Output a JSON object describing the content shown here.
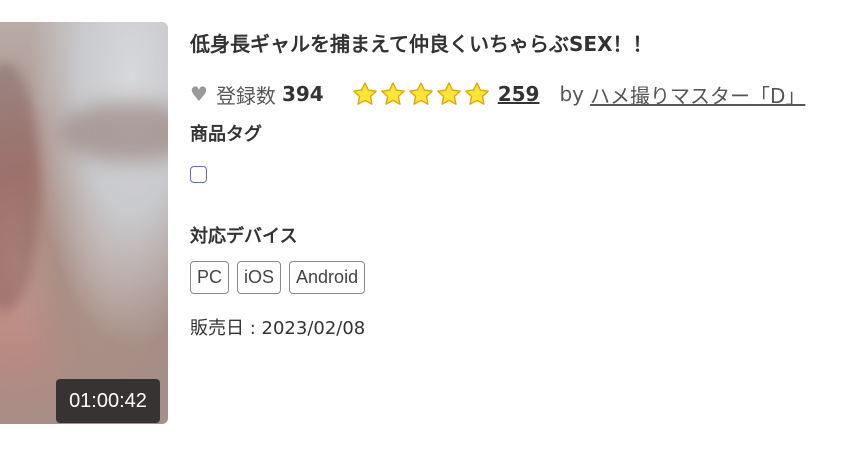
{
  "thumbnail": {
    "duration": "01:00:42"
  },
  "product": {
    "title": "低身長ギャルを捕まえて仲良くいちゃらぶSEX！！",
    "heart_icon": "♥",
    "favorites_label": "登録数",
    "favorites_count": "394",
    "rating_stars": 5,
    "review_count": "259",
    "by_label": "by",
    "maker": "ハメ撮りマスター「D」"
  },
  "tags": {
    "label": "商品タグ"
  },
  "devices": {
    "label": "対応デバイス",
    "items": [
      "PC",
      "iOS",
      "Android"
    ]
  },
  "release": {
    "text": "販売日 : 2023/02/08"
  },
  "colors": {
    "star_fill": "#ffe53b",
    "star_stroke": "#e0a800",
    "checkbox_border": "#5a6fb8"
  }
}
